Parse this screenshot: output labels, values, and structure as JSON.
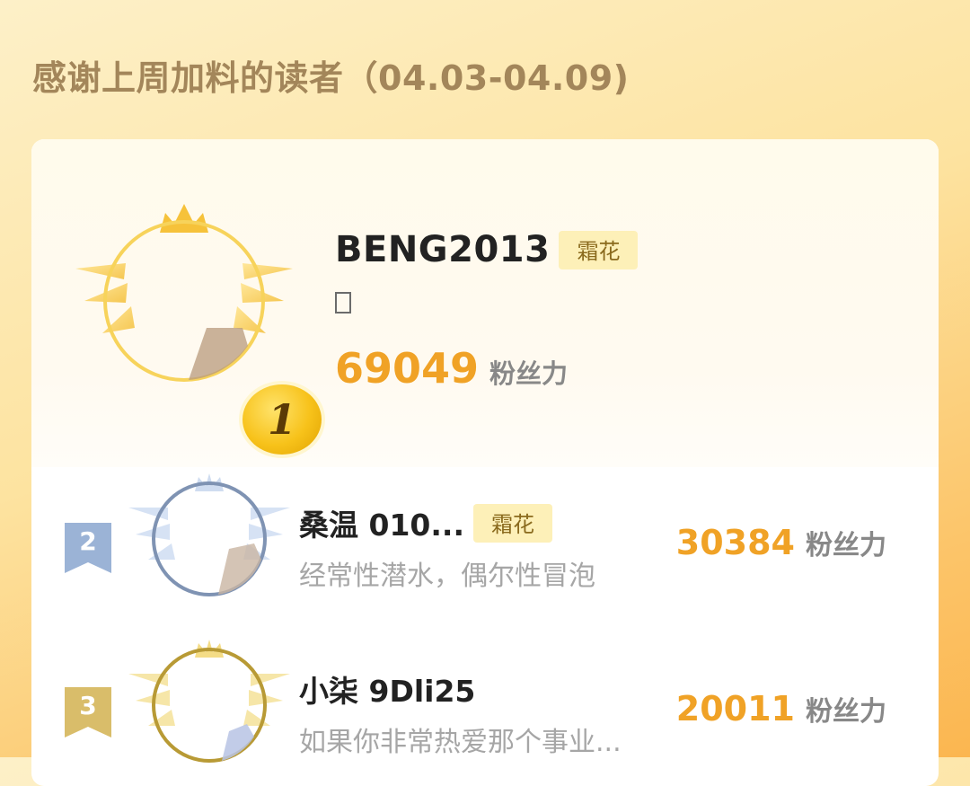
{
  "header": {
    "title": "感谢上周加料的读者（04.03-04.09)"
  },
  "top_reader": {
    "rank": "1",
    "name": "BENG2013",
    "badge": "霜花",
    "fans_value": "69049",
    "fans_unit": "粉丝力",
    "medal_color": "#f7c21a"
  },
  "readers": [
    {
      "rank": "2",
      "name": "桑温  010...",
      "badge": "霜花",
      "signature": "经常性潜水，偶尔性冒泡",
      "fans_value": "30384",
      "fans_unit": "粉丝力",
      "tag_color": "#9bb3d6"
    },
    {
      "rank": "3",
      "name": "小柒  9Dli25",
      "badge": "",
      "signature": "如果你非常热爱那个事业...",
      "fans_value": "20011",
      "fans_unit": "粉丝力",
      "tag_color": "#d9bd6a"
    }
  ],
  "colors": {
    "accent": "#f0a226",
    "badge_bg": "#fdf0b8"
  }
}
